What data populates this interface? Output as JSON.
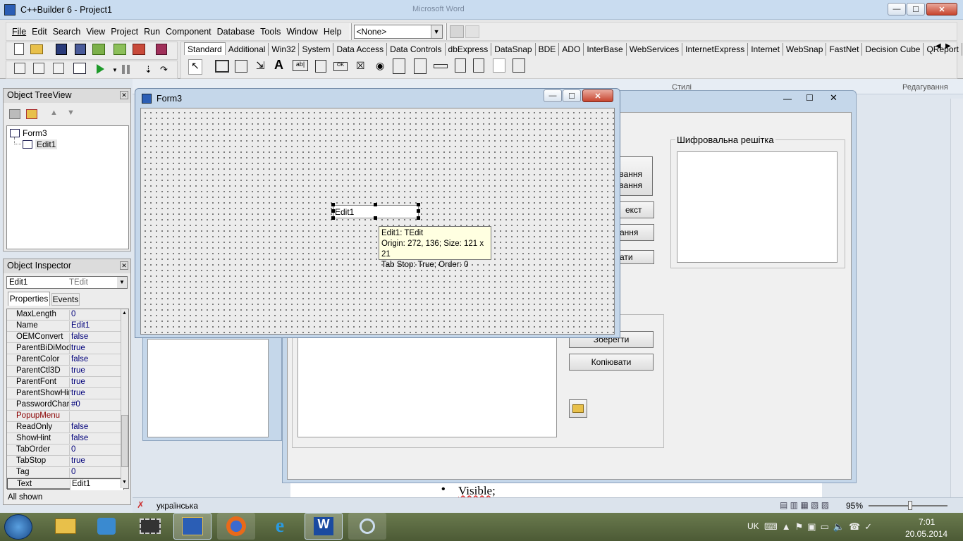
{
  "app": {
    "title": "C++Builder 6 - Project1",
    "bg_window_title": "Microsoft Word"
  },
  "menu": [
    "File",
    "Edit",
    "Search",
    "View",
    "Project",
    "Run",
    "Component",
    "Database",
    "Tools",
    "Window",
    "Help"
  ],
  "toolbar": {
    "config_value": "<None>"
  },
  "palette_tabs": [
    "Standard",
    "Additional",
    "Win32",
    "System",
    "Data Access",
    "Data Controls",
    "dbExpress",
    "DataSnap",
    "BDE",
    "ADO",
    "InterBase",
    "WebServices",
    "InternetExpress",
    "Internet",
    "WebSnap",
    "FastNet",
    "Decision Cube",
    "QReport"
  ],
  "tree_view": {
    "title": "Object TreeView",
    "items": [
      "Form3",
      "Edit1"
    ]
  },
  "inspector": {
    "title": "Object Inspector",
    "object_name": "Edit1",
    "object_type": "TEdit",
    "tabs": [
      "Properties",
      "Events"
    ],
    "rows": [
      {
        "name": "MaxLength",
        "value": "0"
      },
      {
        "name": "Name",
        "value": "Edit1"
      },
      {
        "name": "OEMConvert",
        "value": "false"
      },
      {
        "name": "ParentBiDiMod",
        "value": "true"
      },
      {
        "name": "ParentColor",
        "value": "false"
      },
      {
        "name": "ParentCtl3D",
        "value": "true"
      },
      {
        "name": "ParentFont",
        "value": "true"
      },
      {
        "name": "ParentShowHir",
        "value": "true"
      },
      {
        "name": "PasswordChar",
        "value": "#0"
      },
      {
        "name": "PopupMenu",
        "value": ""
      },
      {
        "name": "ReadOnly",
        "value": "false"
      },
      {
        "name": "ShowHint",
        "value": "false"
      },
      {
        "name": "TabOrder",
        "value": "0"
      },
      {
        "name": "TabStop",
        "value": "true"
      },
      {
        "name": "Tag",
        "value": "0"
      },
      {
        "name": "Text",
        "value": "Edit1"
      }
    ],
    "status": "All shown"
  },
  "form3": {
    "title": "Form3",
    "edit_text": "Edit1",
    "hint_lines": [
      "Edit1: TEdit",
      "Origin: 272, 136; Size: 121 x 21",
      "Tab Stop: True; Order: 0"
    ]
  },
  "bg_form": {
    "group_title": "Шифровальна решітка",
    "btn_partial_1": "вання",
    "btn_partial_1b": "ування",
    "btn_partial_2": "екст",
    "btn_partial_3": "ання",
    "btn_partial_4": "ати",
    "save": "Зберегти",
    "copy": "Копіювати"
  },
  "word": {
    "ribbon_group_1": "Стилі",
    "ribbon_group_2": "Редагування",
    "bullet_text": "Visible;",
    "language": "українська",
    "zoom": "95%"
  },
  "taskbar": {
    "lang": "UK",
    "time": "7:01",
    "date": "20.05.2014"
  }
}
